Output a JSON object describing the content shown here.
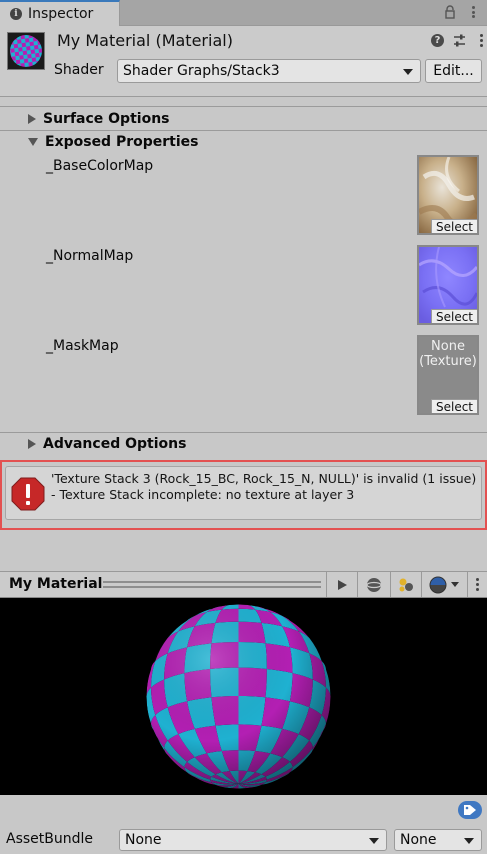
{
  "tab": {
    "title": "Inspector"
  },
  "header": {
    "material_title": "My Material (Material)",
    "shader_label": "Shader",
    "shader_value": "Shader Graphs/Stack3",
    "edit_label": "Edit..."
  },
  "sections": {
    "surface_options": "Surface Options",
    "exposed_properties": "Exposed Properties",
    "advanced_options": "Advanced Options"
  },
  "properties": [
    {
      "label": "_BaseColorMap",
      "select_label": "Select"
    },
    {
      "label": "_NormalMap",
      "select_label": "Select"
    },
    {
      "label": "_MaskMap",
      "select_label": "Select",
      "none_text": "None\n(Texture)",
      "none_line1": "None",
      "none_line2": "(Texture)"
    }
  ],
  "error": {
    "line1": "'Texture Stack 3 (Rock_15_BC, Rock_15_N, NULL)' is invalid (1 issue)",
    "line2": "- Texture Stack incomplete: no texture at layer 3",
    "icon": "error-octagon-icon"
  },
  "preview": {
    "title": "My Material"
  },
  "asset_bundle": {
    "label": "AssetBundle",
    "name_value": "None",
    "variant_value": "None"
  },
  "colors": {
    "accent": "#3a79bb",
    "error_border": "#e35151",
    "error_icon": "#c62828",
    "checker_magenta": "#b31fb3",
    "checker_cyan": "#1fb1d1"
  }
}
